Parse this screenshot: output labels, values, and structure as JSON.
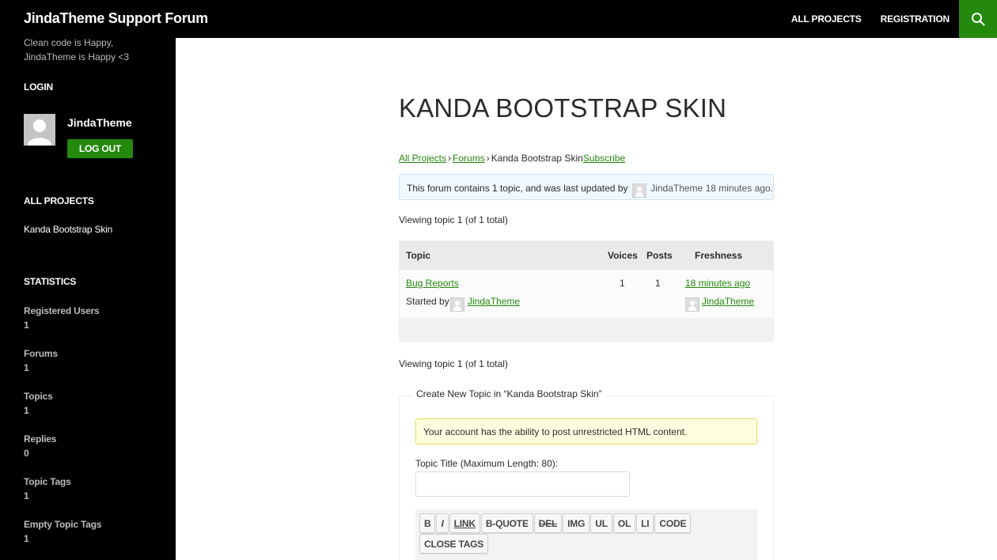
{
  "site": {
    "title": "JindaTheme Support Forum",
    "tagline": "Clean code is Happy, JindaTheme is Happy <3",
    "brand_color": "#24890d"
  },
  "nav": {
    "items": [
      {
        "label": "ALL PROJECTS"
      },
      {
        "label": "REGISTRATION"
      }
    ],
    "search_icon": "search-icon"
  },
  "sidebar": {
    "login": {
      "title": "LOGIN",
      "username": "JindaTheme",
      "logout_label": "LOG OUT"
    },
    "projects": {
      "title": "ALL PROJECTS",
      "items": [
        {
          "label": "Kanda Bootstrap Skin"
        }
      ]
    },
    "statistics": {
      "title": "STATISTICS",
      "items": [
        {
          "label": "Registered Users",
          "value": "1"
        },
        {
          "label": "Forums",
          "value": "1"
        },
        {
          "label": "Topics",
          "value": "1"
        },
        {
          "label": "Replies",
          "value": "0"
        },
        {
          "label": "Topic Tags",
          "value": "1"
        },
        {
          "label": "Empty Topic Tags",
          "value": "1"
        }
      ]
    }
  },
  "main": {
    "title": "KANDA BOOTSTRAP SKIN",
    "breadcrumb": {
      "items": [
        "All Projects",
        "Forums"
      ],
      "separator": "›",
      "current": "Kanda Bootstrap Skin",
      "subscribe": "Subscribe"
    },
    "info": {
      "text": "This forum contains 1 topic, and was last updated by",
      "author": "JindaTheme",
      "time": "18 minutes ago."
    },
    "viewing_top": "Viewing topic 1 (of 1 total)",
    "viewing_bottom": "Viewing topic 1 (of 1 total)",
    "table": {
      "headers": {
        "topic": "Topic",
        "voices": "Voices",
        "posts": "Posts",
        "freshness": "Freshness"
      },
      "rows": [
        {
          "title": "Bug Reports",
          "started_by_label": "Started by:",
          "author": "JindaTheme",
          "voices": "1",
          "posts": "1",
          "freshness": "18 minutes ago",
          "last_author": "JindaTheme"
        }
      ]
    },
    "new_topic": {
      "legend": "Create New Topic in “Kanda Bootstrap Skin”",
      "notice": "Your account has the ability to post unrestricted HTML content.",
      "title_label": "Topic Title (Maximum Length: 80):",
      "title_value": "",
      "title_placeholder": "",
      "toolbar": [
        "B",
        "I",
        "LINK",
        "B-QUOTE",
        "DEL",
        "IMG",
        "UL",
        "OL",
        "LI",
        "CODE",
        "CLOSE TAGS"
      ]
    }
  }
}
